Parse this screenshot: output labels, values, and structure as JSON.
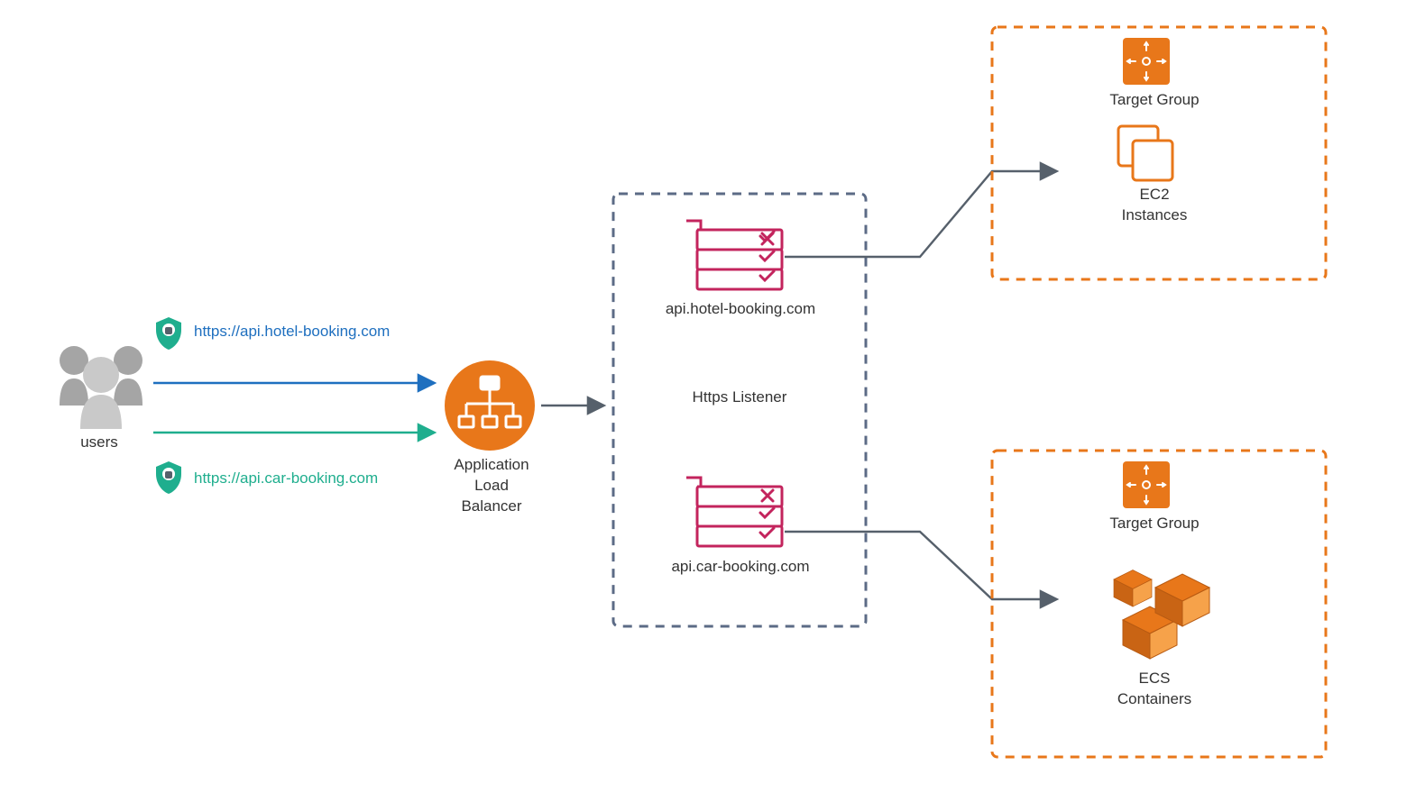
{
  "users": {
    "label": "users"
  },
  "requests": {
    "top": {
      "url": "https://api.hotel-booking.com",
      "color": "#1E6FBF"
    },
    "bottom": {
      "url": "https://api.car-booking.com",
      "color": "#1FAE8E"
    }
  },
  "alb": {
    "label_line1": "Application",
    "label_line2": "Load",
    "label_line3": "Balancer"
  },
  "listener": {
    "title": "Https Listener",
    "rule_top": {
      "domain": "api.hotel-booking.com"
    },
    "rule_bottom": {
      "domain": "api.car-booking.com"
    }
  },
  "target_groups": {
    "top": {
      "title": "Target Group",
      "resource_line1": "EC2",
      "resource_line2": "Instances"
    },
    "bottom": {
      "title": "Target Group",
      "resource_line1": "ECS",
      "resource_line2": "Containers"
    }
  },
  "colors": {
    "orange": "#E8771A",
    "orangeLight": "#F6A24A",
    "magenta": "#C3245D",
    "slate": "#56606B",
    "dashBlue": "#5C6B86",
    "teal": "#1FAE8E",
    "blue": "#1E6FBF",
    "gray": "#A5A5A5"
  }
}
